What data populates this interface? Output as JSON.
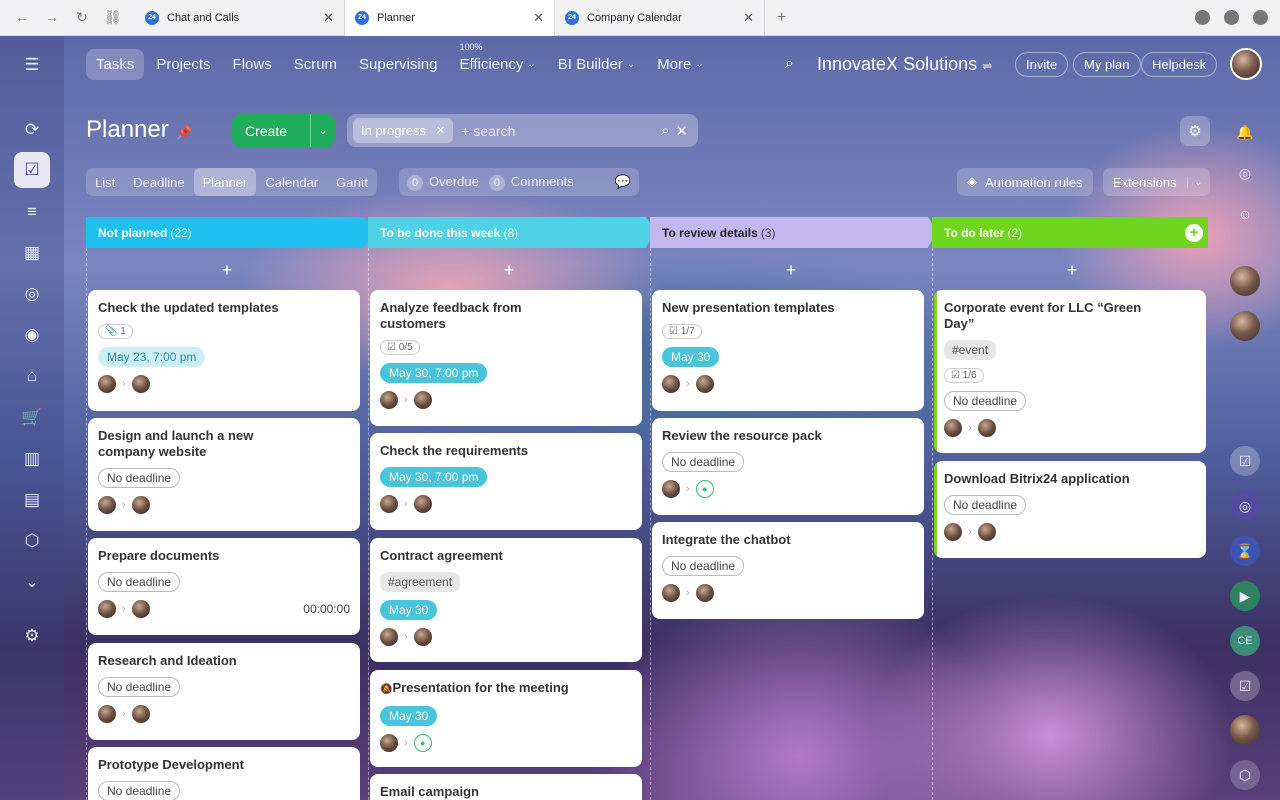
{
  "browser": {
    "tabs": [
      {
        "label": "Chat and Calls",
        "favicon": "24"
      },
      {
        "label": "Planner",
        "favicon": "24"
      },
      {
        "label": "Company Calendar",
        "favicon": "24"
      }
    ],
    "close": "✕",
    "new_tab": "+"
  },
  "topnav": {
    "items": [
      "Tasks",
      "Projects",
      "Flows",
      "Scrum",
      "Supervising",
      "Efficiency",
      "BI Builder",
      "More"
    ],
    "efficiency_pct": "100%",
    "company": "InnovateX Solutions",
    "invite": "Invite",
    "my_plan": "My plan",
    "helpdesk": "Helpdesk"
  },
  "header": {
    "title": "Planner",
    "create": "Create",
    "filter_chip": "In progress",
    "search_placeholder": "+ search",
    "views": [
      "List",
      "Deadline",
      "Planner",
      "Calendar",
      "Gantt"
    ],
    "overdue_count": "0",
    "overdue": "Overdue",
    "comments_count": "0",
    "comments": "Comments",
    "automation": "Automation rules",
    "extensions": "Extensions"
  },
  "columns": [
    {
      "title": "Not planned",
      "count": "(22)",
      "color": "#1ec0f0"
    },
    {
      "title": "To be done this week",
      "count": "(8)",
      "color": "#4fd2e5"
    },
    {
      "title": "To review details",
      "count": "(3)",
      "color": "#c4b7ef"
    },
    {
      "title": "To do later",
      "count": "(2)",
      "color": "#6fd51e"
    }
  ],
  "cards": {
    "c1": {
      "title": "Check the updated templates",
      "counter": "1",
      "date": "May 23, 7:00 pm"
    },
    "c2": {
      "title": "Design and launch a new company website",
      "deadline": "No deadline"
    },
    "c3": {
      "title": "Prepare documents",
      "deadline": "No deadline",
      "timer": "00:00:00"
    },
    "c4": {
      "title": "Research and Ideation",
      "deadline": "No deadline"
    },
    "c5": {
      "title": "Prototype Development",
      "deadline": "No deadline"
    },
    "d1": {
      "title": "Analyze feedback from customers",
      "counter": "0/5",
      "date": "May 30, 7:00 pm"
    },
    "d2": {
      "title": "Check the requirements",
      "date": "May 30, 7:00 pm"
    },
    "d3": {
      "title": "Contract agreement",
      "tag": "#agreement",
      "date": "May 30"
    },
    "d4": {
      "title": "Presentation for the meeting",
      "date": "May 30"
    },
    "d5": {
      "title": "Email campaign"
    },
    "e1": {
      "title": "New presentation templates",
      "counter": "1/7",
      "date": "May 30"
    },
    "e2": {
      "title": "Review the resource pack",
      "deadline": "No deadline"
    },
    "e3": {
      "title": "Integrate the chatbot",
      "deadline": "No deadline"
    },
    "f1": {
      "title": "Corporate event for LLC “Green Day”",
      "tag": "#event",
      "counter": "1/6",
      "deadline": "No deadline"
    },
    "f2": {
      "title": "Download Bitrix24 application",
      "deadline": "No deadline"
    }
  }
}
